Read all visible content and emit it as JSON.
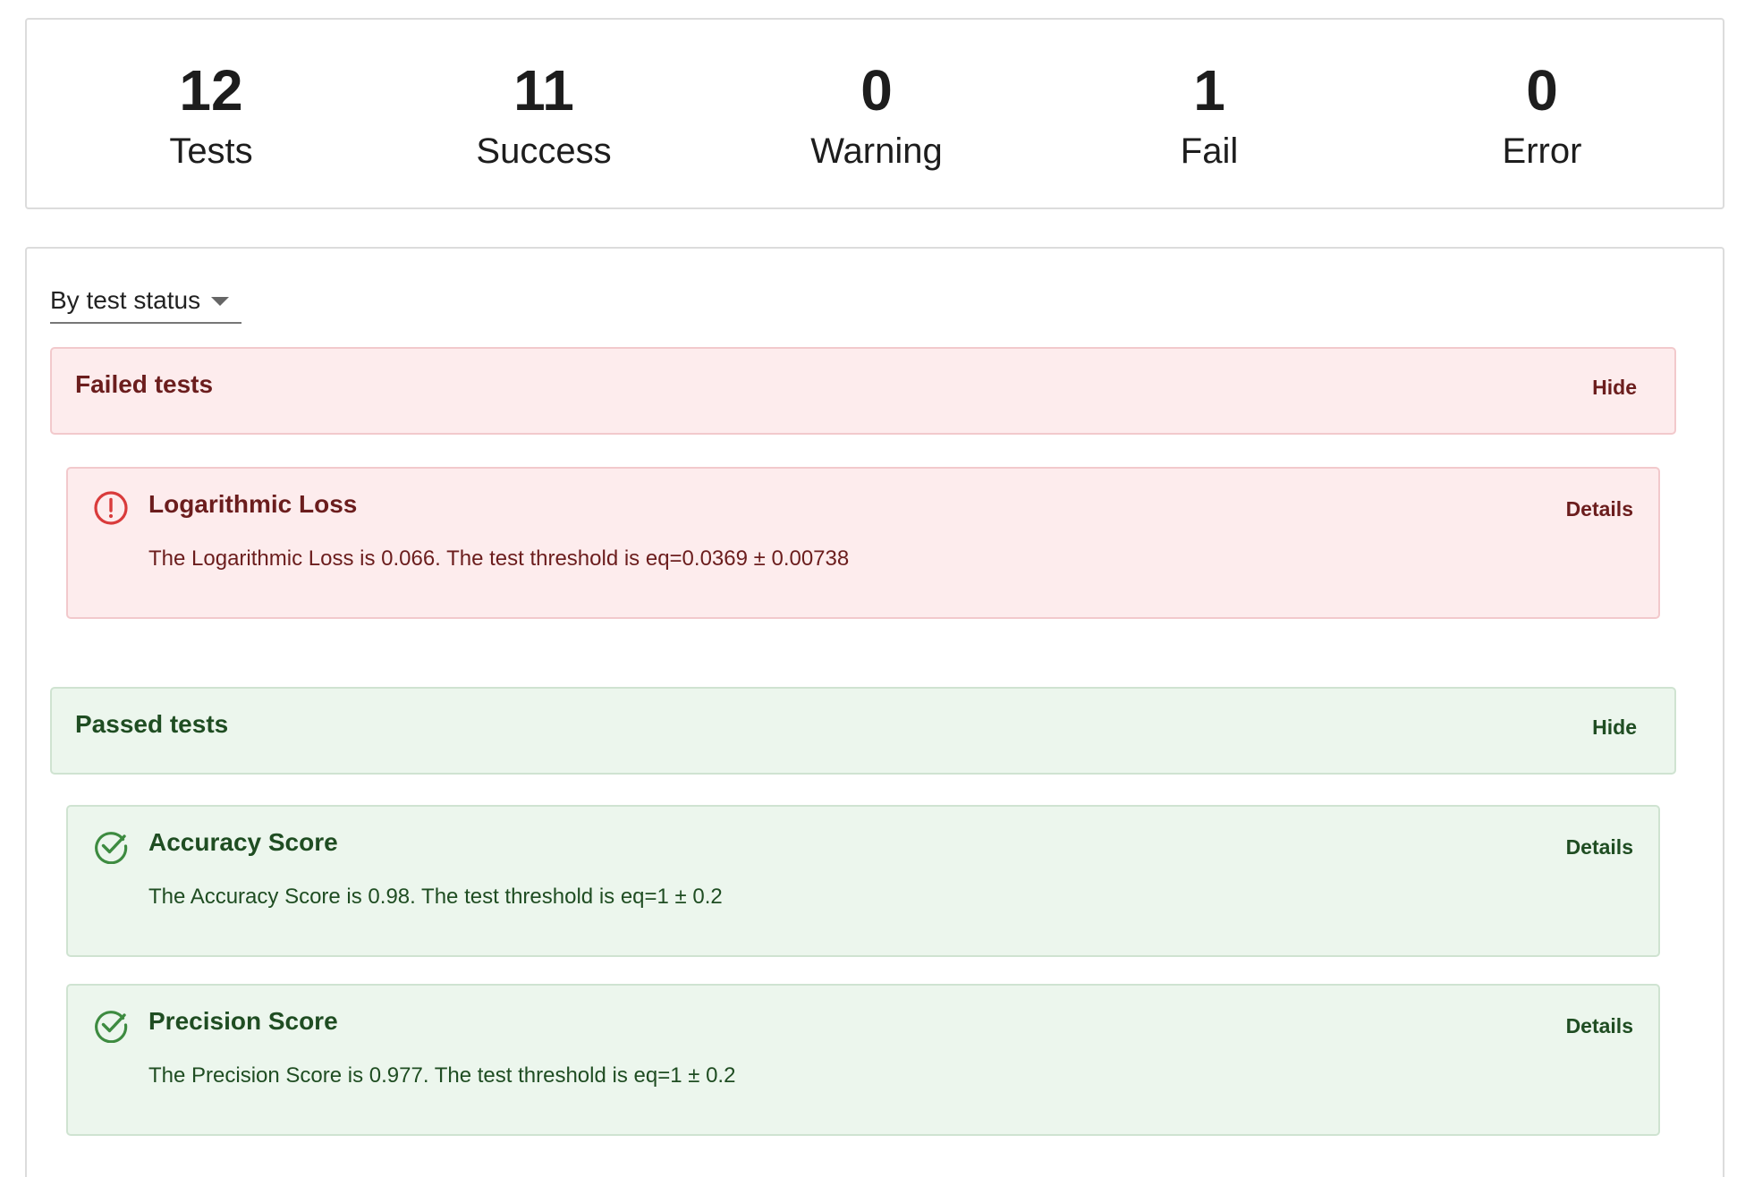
{
  "summary": [
    {
      "value": "12",
      "label": "Tests"
    },
    {
      "value": "11",
      "label": "Success"
    },
    {
      "value": "0",
      "label": "Warning"
    },
    {
      "value": "1",
      "label": "Fail"
    },
    {
      "value": "0",
      "label": "Error"
    }
  ],
  "grouping": {
    "selected": "By test status"
  },
  "failed_section": {
    "title": "Failed tests",
    "toggle_label": "Hide",
    "tests": [
      {
        "name": "Logarithmic Loss",
        "details_label": "Details",
        "description": "The Logarithmic Loss is 0.066. The test threshold is eq=0.0369 ± 0.00738",
        "icon": "alert-circle-icon"
      }
    ]
  },
  "passed_section": {
    "title": "Passed tests",
    "toggle_label": "Hide",
    "tests": [
      {
        "name": "Accuracy Score",
        "details_label": "Details",
        "description": "The Accuracy Score is 0.98. The test threshold is eq=1 ± 0.2",
        "icon": "check-circle-icon"
      },
      {
        "name": "Precision Score",
        "details_label": "Details",
        "description": "The Precision Score is 0.977. The test threshold is eq=1 ± 0.2",
        "icon": "check-circle-icon"
      }
    ]
  },
  "colors": {
    "fail_bg": "#fdeced",
    "fail_text": "#6b1d1d",
    "fail_icon": "#d93b3b",
    "pass_bg": "#ecf6ed",
    "pass_text": "#1f4d22",
    "pass_icon": "#3d8b40"
  }
}
